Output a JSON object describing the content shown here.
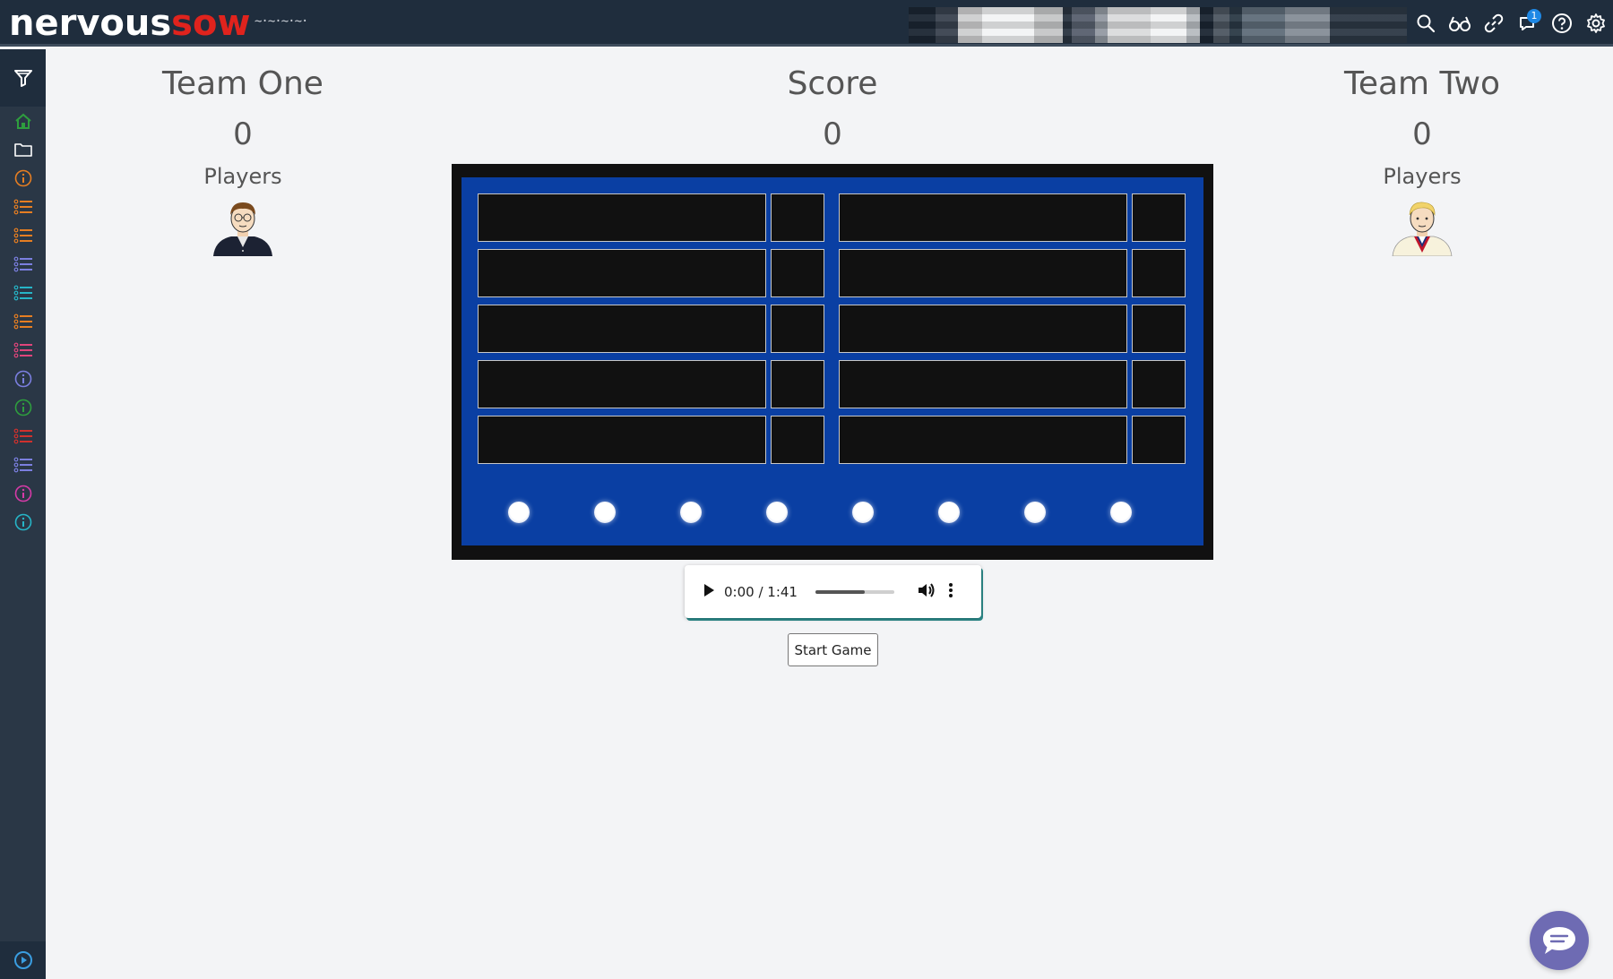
{
  "header": {
    "logo_part1": "nervous",
    "logo_part2": "sow",
    "logo_tagline": "~·~·~·~·",
    "icons": [
      "search-icon",
      "glasses-icon",
      "link-icon",
      "chat-icon",
      "help-icon",
      "gear-icon"
    ],
    "notification_count": "1"
  },
  "sidebar": {
    "top_icon": "filter-icon",
    "items": [
      {
        "icon": "home-icon",
        "color": "#2e9e3e"
      },
      {
        "icon": "folder-icon",
        "color": "#ffffff"
      },
      {
        "icon": "info-icon",
        "color": "#e67e22"
      },
      {
        "icon": "list-icon",
        "color": "#e67e22"
      },
      {
        "icon": "list-icon",
        "color": "#e67e22"
      },
      {
        "icon": "list-icon",
        "color": "#7b7fe0"
      },
      {
        "icon": "list-icon",
        "color": "#26b5c7"
      },
      {
        "icon": "list-icon",
        "color": "#e67e22"
      },
      {
        "icon": "list-icon",
        "color": "#e0457b"
      },
      {
        "icon": "info-icon",
        "color": "#7b7fe0"
      },
      {
        "icon": "info-icon",
        "color": "#2e9e3e"
      },
      {
        "icon": "list-icon",
        "color": "#d0312d"
      },
      {
        "icon": "list-icon",
        "color": "#7b7fe0"
      },
      {
        "icon": "info-icon",
        "color": "#d63aa8"
      },
      {
        "icon": "info-icon",
        "color": "#26b5c7"
      }
    ],
    "bottom_icon": "play-circle-icon"
  },
  "game": {
    "team_one": {
      "name": "Team One",
      "score": "0",
      "players_label": "Players"
    },
    "score": {
      "label": "Score",
      "value": "0"
    },
    "team_two": {
      "name": "Team Two",
      "score": "0",
      "players_label": "Players"
    },
    "board": {
      "rows": 5,
      "columns": 2,
      "strike_indicators": 8,
      "colors": {
        "frame": "#111111",
        "board": "#0a3fa3",
        "slot": "#111111"
      }
    },
    "audio": {
      "time": "0:00 / 1:41",
      "progress_fraction": 0.63
    },
    "start_button": "Start Game"
  }
}
